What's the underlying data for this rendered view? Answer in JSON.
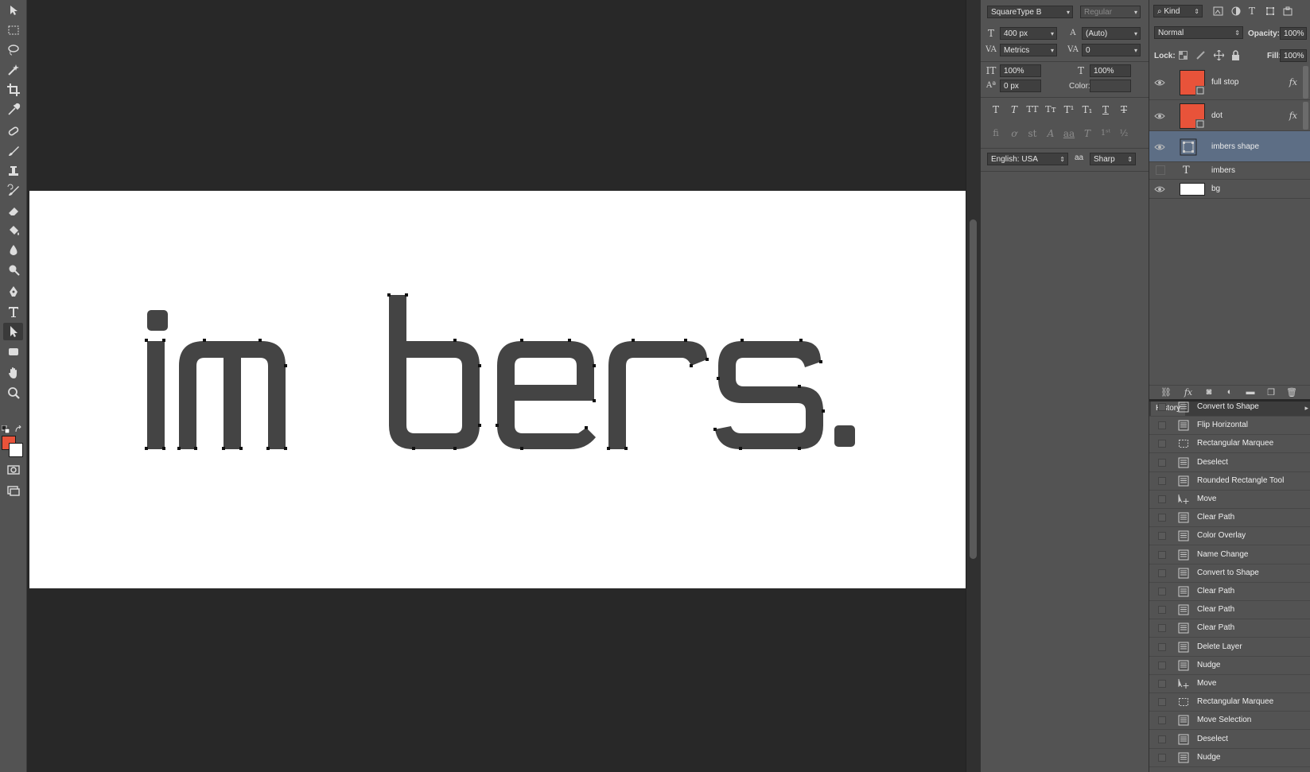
{
  "tools": [
    {
      "name": "move-tool-icon"
    },
    {
      "name": "rectangular-marquee-tool-icon"
    },
    {
      "name": "lasso-tool-icon"
    },
    {
      "name": "magic-wand-tool-icon"
    },
    {
      "name": "crop-tool-icon"
    },
    {
      "name": "eyedropper-tool-icon"
    },
    {
      "name": "spot-healing-tool-icon"
    },
    {
      "name": "brush-tool-icon"
    },
    {
      "name": "clone-stamp-tool-icon"
    },
    {
      "name": "history-brush-tool-icon"
    },
    {
      "name": "eraser-tool-icon"
    },
    {
      "name": "paint-bucket-tool-icon"
    },
    {
      "name": "blur-tool-icon"
    },
    {
      "name": "dodge-tool-icon"
    },
    {
      "name": "pen-tool-icon"
    },
    {
      "name": "type-tool-icon"
    },
    {
      "name": "path-selection-tool-icon"
    },
    {
      "name": "rectangle-tool-icon"
    },
    {
      "name": "hand-tool-icon"
    },
    {
      "name": "zoom-tool-icon"
    }
  ],
  "colors": {
    "foreground": "#e8533a",
    "background": "#ffffff",
    "accent_selection": "#5d6e85"
  },
  "canvas": {
    "text": "imbers",
    "full_stop": ".",
    "text_color": "#444444"
  },
  "character": {
    "font_family": "SquareType B",
    "font_style": "Regular",
    "font_size": "400 px",
    "leading": "(Auto)",
    "kerning": "Metrics",
    "tracking": "0",
    "vertical_scale": "100%",
    "horizontal_scale": "100%",
    "baseline_shift": "0 px",
    "color_label": "Color:",
    "language": "English: USA",
    "antialias_icon": "aa",
    "antialias": "Sharp"
  },
  "layers": {
    "kind_label": "Kind",
    "blend_mode": "Normal",
    "opacity_label": "Opacity:",
    "opacity_value": "100%",
    "lock_label": "Lock:",
    "fill_label": "Fill:",
    "fill_value": "100%",
    "items": [
      {
        "name": "full stop",
        "visible": true,
        "selected": false,
        "thumb": "shape",
        "fx": "fx"
      },
      {
        "name": "dot",
        "visible": true,
        "selected": false,
        "thumb": "shape",
        "fx": "fx"
      },
      {
        "name": "imbers shape",
        "visible": true,
        "selected": true,
        "thumb": "path",
        "fx": ""
      },
      {
        "name": "imbers",
        "visible": false,
        "selected": false,
        "thumb": "type",
        "fx": ""
      },
      {
        "name": "bg",
        "visible": true,
        "selected": false,
        "thumb": "white",
        "fx": ""
      }
    ]
  },
  "history": {
    "tab_label": "History",
    "items": [
      {
        "label": "Convert to Shape",
        "icon": "doc"
      },
      {
        "label": "Flip Horizontal",
        "icon": "doc"
      },
      {
        "label": "Rectangular Marquee",
        "icon": "marquee"
      },
      {
        "label": "Deselect",
        "icon": "doc"
      },
      {
        "label": "Rounded Rectangle Tool",
        "icon": "doc"
      },
      {
        "label": "Move",
        "icon": "move"
      },
      {
        "label": "Clear Path",
        "icon": "doc"
      },
      {
        "label": "Color Overlay",
        "icon": "doc"
      },
      {
        "label": "Name Change",
        "icon": "doc"
      },
      {
        "label": "Convert to Shape",
        "icon": "doc"
      },
      {
        "label": "Clear Path",
        "icon": "doc"
      },
      {
        "label": "Clear Path",
        "icon": "doc"
      },
      {
        "label": "Clear Path",
        "icon": "doc"
      },
      {
        "label": "Delete Layer",
        "icon": "doc"
      },
      {
        "label": "Nudge",
        "icon": "doc"
      },
      {
        "label": "Move",
        "icon": "move"
      },
      {
        "label": "Rectangular Marquee",
        "icon": "marquee"
      },
      {
        "label": "Move Selection",
        "icon": "doc"
      },
      {
        "label": "Deselect",
        "icon": "doc"
      },
      {
        "label": "Nudge",
        "icon": "doc"
      }
    ]
  }
}
